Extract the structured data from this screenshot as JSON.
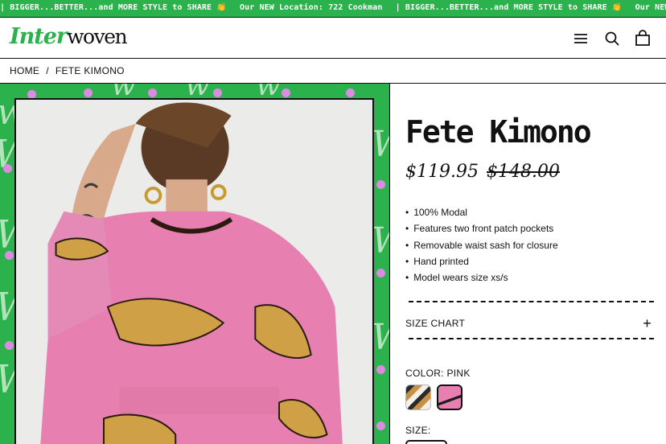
{
  "announcement": {
    "messages": [
      "| BIGGER...BETTER...and MORE STYLE to SHARE 👏",
      "Our NEW Location: 722 Cookman",
      "| BIGGER...BETTER...and MORE STYLE to SHARE 👏",
      "Our NEW Location:"
    ]
  },
  "header": {
    "logo_part1": "Inter",
    "logo_part2": "woven",
    "icons": [
      "menu-icon",
      "search-icon",
      "cart-icon"
    ]
  },
  "breadcrumb": {
    "home": "HOME",
    "separator": "/",
    "current": "FETE KIMONO"
  },
  "product": {
    "title": "Fete Kimono",
    "price_sale": "$119.95",
    "price_compare": "$148.00",
    "features": [
      "100% Modal",
      "Features two front patch pockets",
      "Removable waist sash for closure",
      "Hand printed",
      "Model wears size xs/s"
    ],
    "size_chart_label": "SIZE CHART",
    "size_chart_toggle": "+",
    "color_label": "COLOR: PINK",
    "color_options": [
      "tiger-print",
      "pink"
    ],
    "selected_color": "pink",
    "size_label": "SIZE:"
  },
  "colors": {
    "brand_green": "#2bb24c",
    "kimono_pink": "#e780b0",
    "dot_pink": "#d98ce0"
  }
}
